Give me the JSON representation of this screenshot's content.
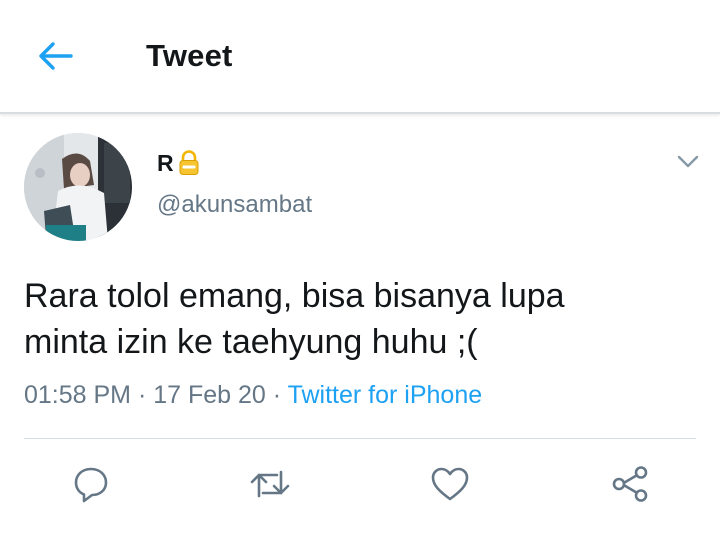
{
  "header": {
    "back_icon": "arrow-left-icon",
    "title": "Tweet",
    "accent_color": "#1da1f2"
  },
  "tweet": {
    "display_name": "R",
    "protected_icon": "lock-icon",
    "handle": "@akunsambat",
    "menu_icon": "chevron-down-icon",
    "text_line_1": "Rara tolol emang, bisa bisanya lupa",
    "text_line_2": "minta izin ke taehyung huhu ;(",
    "time": "01:58 PM",
    "separator": " · ",
    "date": "17 Feb 20",
    "source": "Twitter for iPhone"
  },
  "actions": {
    "reply_icon": "reply-icon",
    "retweet_icon": "retweet-icon",
    "like_icon": "heart-icon",
    "share_icon": "share-icon"
  },
  "colors": {
    "text_primary": "#14171a",
    "text_secondary": "#657786",
    "icon": "#657786",
    "divider": "#d8dde2"
  }
}
